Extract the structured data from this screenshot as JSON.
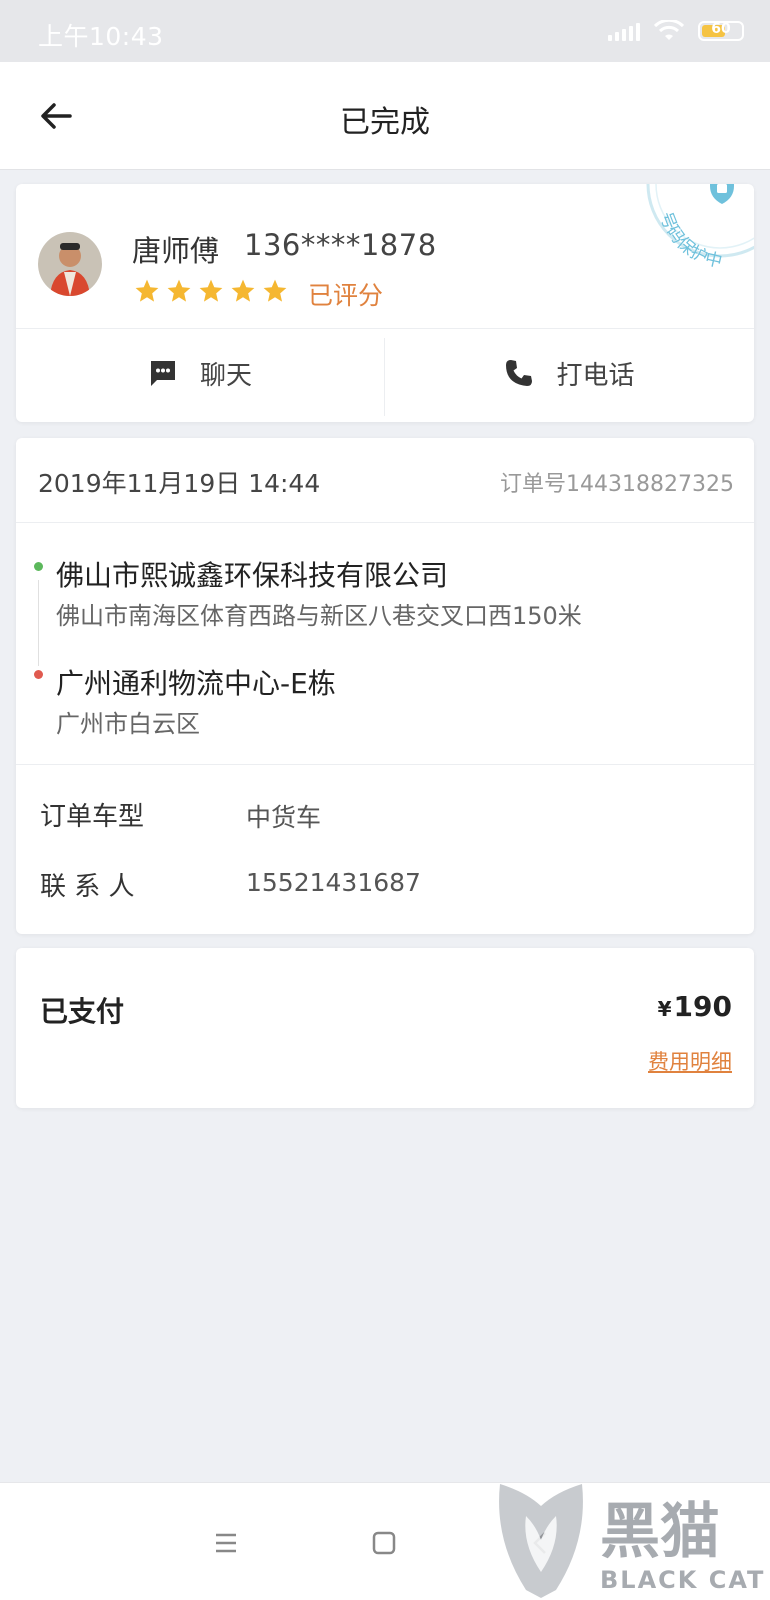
{
  "status_bar": {
    "time": "上午10:43",
    "battery_level": "60"
  },
  "header": {
    "title": "已完成",
    "back_icon": "arrow-left-icon"
  },
  "driver": {
    "name": "唐师傅",
    "phone": "136****1878",
    "rating": 5,
    "rating_max": 5,
    "rated_label": "已评分",
    "privacy_stamp": "号码保护中",
    "chat_label": "聊天",
    "call_label": "打电话"
  },
  "order": {
    "datetime": "2019年11月19日 14:44",
    "order_number": "订单号144318827325",
    "pickup": {
      "name": "佛山市熙诚鑫环保科技有限公司",
      "address": "佛山市南海区体育西路与新区八巷交叉口西150米"
    },
    "dropoff": {
      "name": "广州通利物流中心-E栋",
      "address": "广州市白云区"
    },
    "vehicle_label": "订单车型",
    "vehicle_value": "中货车",
    "contact_label": "联 系 人",
    "contact_value": "15521431687"
  },
  "payment": {
    "status": "已支付",
    "currency": "¥",
    "amount": "190",
    "detail_link": "费用明细"
  },
  "watermark": {
    "brand": "黑猫",
    "brand_en": "BLACK CAT"
  },
  "colors": {
    "accent": "#e0823e",
    "star": "#f5b731",
    "pickup_dot": "#5cb85c",
    "dropoff_dot": "#e05a4f"
  }
}
